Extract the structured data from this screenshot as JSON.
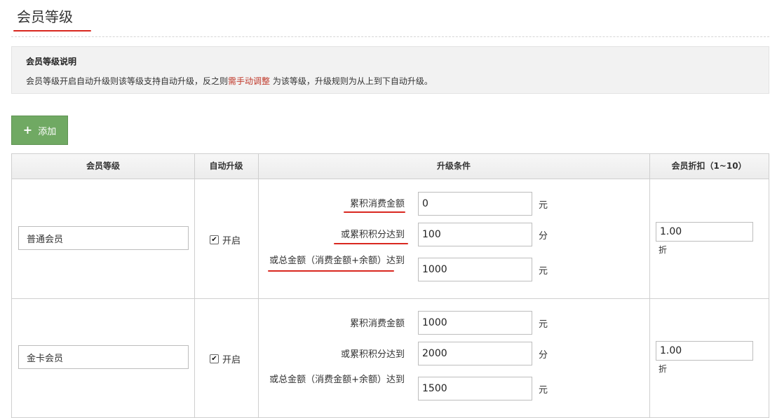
{
  "page": {
    "title": "会员等级"
  },
  "info": {
    "title": "会员等级说明",
    "text_before": "会员等级开启自动升级则该等级支持自动升级，反之则",
    "text_highlight": "需手动调整",
    "text_after": "为该等级，升级规则为从上到下自动升级。"
  },
  "toolbar": {
    "add_label": "添加"
  },
  "table": {
    "headers": {
      "level": "会员等级",
      "auto": "自动升级",
      "condition": "升级条件",
      "discount": "会员折扣（1~10）"
    },
    "rows": [
      {
        "name": "普通会员",
        "auto_label": "开启",
        "auto_checked": true,
        "conditions": [
          {
            "label": "累积消费金额",
            "value": "0",
            "unit": "元"
          },
          {
            "label": "或累积积分达到",
            "value": "100",
            "unit": "分"
          },
          {
            "label": "或总金额（消费金额+余额）达到",
            "value": "1000",
            "unit": "元"
          }
        ],
        "discount": "1.00",
        "discount_unit": "折"
      },
      {
        "name": "金卡会员",
        "auto_label": "开启",
        "auto_checked": true,
        "conditions": [
          {
            "label": "累积消费金额",
            "value": "1000",
            "unit": "元"
          },
          {
            "label": "或累积积分达到",
            "value": "2000",
            "unit": "分"
          },
          {
            "label": "或总金额（消费金额+余额）达到",
            "value": "1500",
            "unit": "元"
          }
        ],
        "discount": "1.00",
        "discount_unit": "折"
      }
    ]
  },
  "colors": {
    "accent_green": "#70a963",
    "highlight_red": "#c0392b",
    "underline_red": "#d9271f"
  }
}
